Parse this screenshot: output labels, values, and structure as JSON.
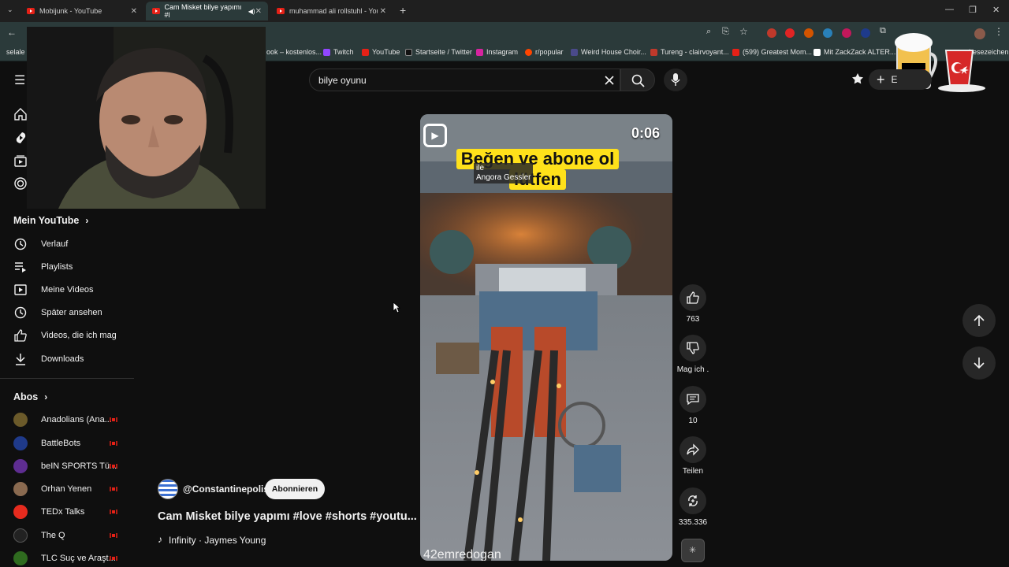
{
  "browser": {
    "tabs": [
      {
        "title": "Mobijunk - YouTube"
      },
      {
        "title": "Cam Misket bilye yapımı #l"
      },
      {
        "title": "muhammad ali rollstuhl - YouTu"
      }
    ],
    "new_tab": "+",
    "minimize": "—",
    "restore": "❐",
    "close": "✕",
    "bookmarks_left": "selale n",
    "bookmarks": [
      {
        "label": "ook – kostenlos...",
        "color": "#3b5998"
      },
      {
        "label": "Twitch",
        "color": "#9146ff"
      },
      {
        "label": "YouTube",
        "color": "#e62117"
      },
      {
        "label": "Startseite / Twitter",
        "color": "#111111"
      },
      {
        "label": "Instagram",
        "color": "#d6249f"
      },
      {
        "label": "r/popular",
        "color": "#ff4500"
      },
      {
        "label": "Weird House Choir...",
        "color": "#4a4a8a"
      },
      {
        "label": "Tureng - clairvoyant...",
        "color": "#c0392b"
      },
      {
        "label": "(599) Greatest Mom...",
        "color": "#e62117"
      },
      {
        "label": "Mit ZackZack ALTER...",
        "color": "#ffffff"
      }
    ],
    "bookmarks_right": "Lesezeichen"
  },
  "search": {
    "value": "bilye oyunu"
  },
  "header": {
    "create_label": "E"
  },
  "sidebar": {
    "my_youtube": "Mein YouTube",
    "items": [
      {
        "label": "Verlauf",
        "icon": "history-icon"
      },
      {
        "label": "Playlists",
        "icon": "playlist-icon"
      },
      {
        "label": "Meine Videos",
        "icon": "my-videos-icon"
      },
      {
        "label": "Später ansehen",
        "icon": "watch-later-icon"
      },
      {
        "label": "Videos, die ich mag",
        "icon": "like-icon"
      },
      {
        "label": "Downloads",
        "icon": "download-icon"
      }
    ],
    "subs_title": "Abos",
    "subs": [
      {
        "label": "Anadolians (Ana...",
        "color": "#6b5a2a"
      },
      {
        "label": "BattleBots",
        "color": "#1f3a8a"
      },
      {
        "label": "beIN SPORTS Tü...",
        "color": "#5e2d91"
      },
      {
        "label": "Orhan Yenen",
        "color": "#8a6a50"
      },
      {
        "label": "TEDx Talks",
        "color": "#e62b1e"
      },
      {
        "label": "The Q",
        "color": "#222222"
      },
      {
        "label": "TLC Suç ve Araşt...",
        "color": "#2f6b1f"
      }
    ]
  },
  "short": {
    "time": "0:06",
    "banner_line1": "Beğen ve abone ol",
    "banner_line2": "lütfen",
    "tooltip_line1": "ile",
    "tooltip_line2": "Angora Gessler",
    "watermark": "42emredogan",
    "channel": "@Constantinepolis",
    "subscribe": "Abonnieren",
    "title": "Cam Misket bilye yapımı #love #shorts #youtu...",
    "music": "Infinity · Jaymes Young"
  },
  "actions": {
    "likes": "763",
    "dislike": "Mag ich .",
    "comments": "10",
    "share": "Teilen",
    "remix": "335.336"
  }
}
